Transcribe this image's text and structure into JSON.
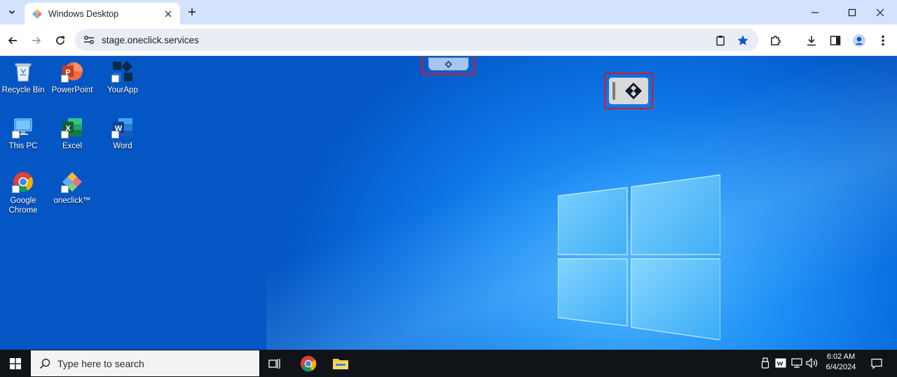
{
  "browser": {
    "tab_title": "Windows Desktop",
    "url": "stage.oneclick.services",
    "colors": {
      "tabstrip": "#d3e3fd",
      "accent": "#0b57d0"
    }
  },
  "desktop": {
    "icons": [
      {
        "label": "Recycle Bin",
        "icon": "recycle-bin-icon"
      },
      {
        "label": "PowerPoint",
        "icon": "powerpoint-icon"
      },
      {
        "label": "YourApp",
        "icon": "yourapp-icon"
      },
      {
        "label": "This PC",
        "icon": "this-pc-icon"
      },
      {
        "label": "Excel",
        "icon": "excel-icon"
      },
      {
        "label": "Word",
        "icon": "word-icon"
      },
      {
        "label": "Google Chrome",
        "icon": "chrome-icon"
      },
      {
        "label": "oneclick™",
        "icon": "oneclick-icon"
      }
    ],
    "highlight_color": "#e0141e"
  },
  "taskbar": {
    "search_placeholder": "Type here to search",
    "time": "6:02 AM",
    "date": "6/4/2024"
  }
}
